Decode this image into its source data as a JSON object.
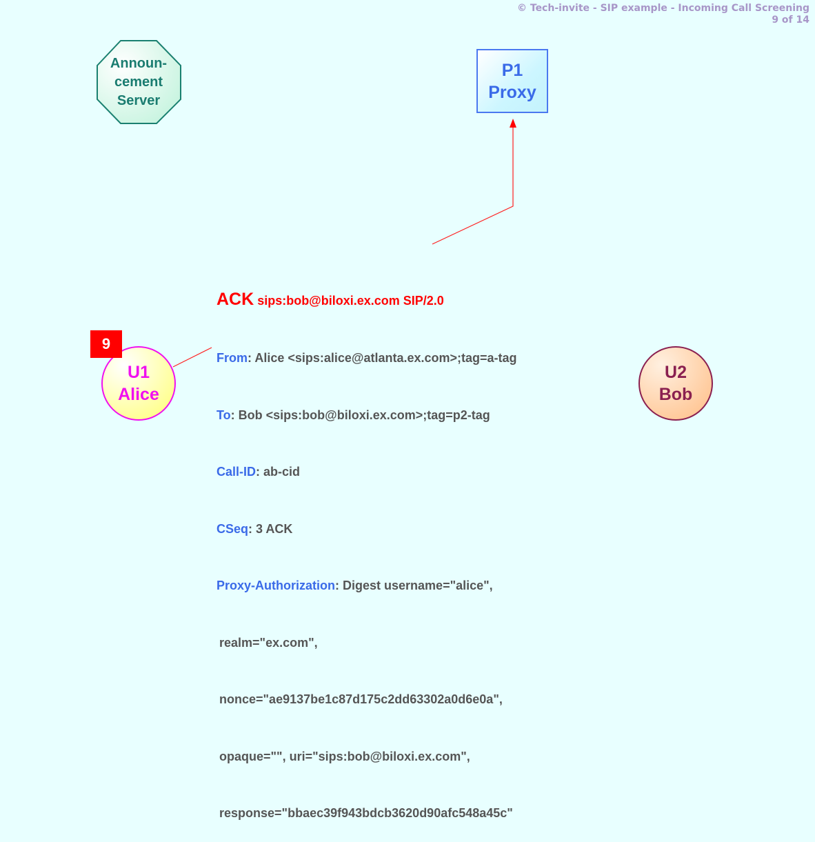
{
  "header": {
    "title": "© Tech-invite - SIP example - Incoming Call Screening",
    "page": "9 of 14"
  },
  "nodes": {
    "announcement_server": {
      "lines": [
        "Announ-",
        "cement",
        "Server"
      ],
      "shape": "octagon",
      "color": "#1a7c70"
    },
    "proxy": {
      "lines": [
        "P1",
        "Proxy"
      ],
      "shape": "rectangle",
      "color": "#3a6ae8"
    },
    "alice": {
      "lines": [
        "U1",
        "Alice"
      ],
      "shape": "circle",
      "color": "#f010f0"
    },
    "bob": {
      "lines": [
        "U2",
        "Bob"
      ],
      "shape": "circle",
      "color": "#8a2050"
    }
  },
  "step": {
    "number": "9",
    "color": "#ff0000"
  },
  "message": {
    "method": "ACK",
    "request_uri": "sips:bob@biloxi.ex.com SIP/2.0",
    "headers": [
      {
        "name": "From",
        "value": ": Alice <sips:alice@atlanta.ex.com>;tag=a-tag"
      },
      {
        "name": "To",
        "value": ": Bob <sips:bob@biloxi.ex.com>;tag=p2-tag"
      },
      {
        "name": "Call-ID",
        "value": ": ab-cid"
      },
      {
        "name": "CSeq",
        "value": ": 3 ACK"
      },
      {
        "name": "Proxy-Authorization",
        "value": ": Digest username=\"alice\","
      }
    ],
    "continuation": [
      "realm=\"ex.com\",",
      "nonce=\"ae9137be1c87d175c2dd63302a0d6e0a\",",
      "opaque=\"\", uri=\"sips:bob@biloxi.ex.com\",",
      "response=\"bbaec39f943bdcb3620d90afc548a45c\""
    ]
  },
  "flow": {
    "from": "U1 Alice",
    "to": "P1 Proxy",
    "arrow_color": "#ff0000"
  }
}
